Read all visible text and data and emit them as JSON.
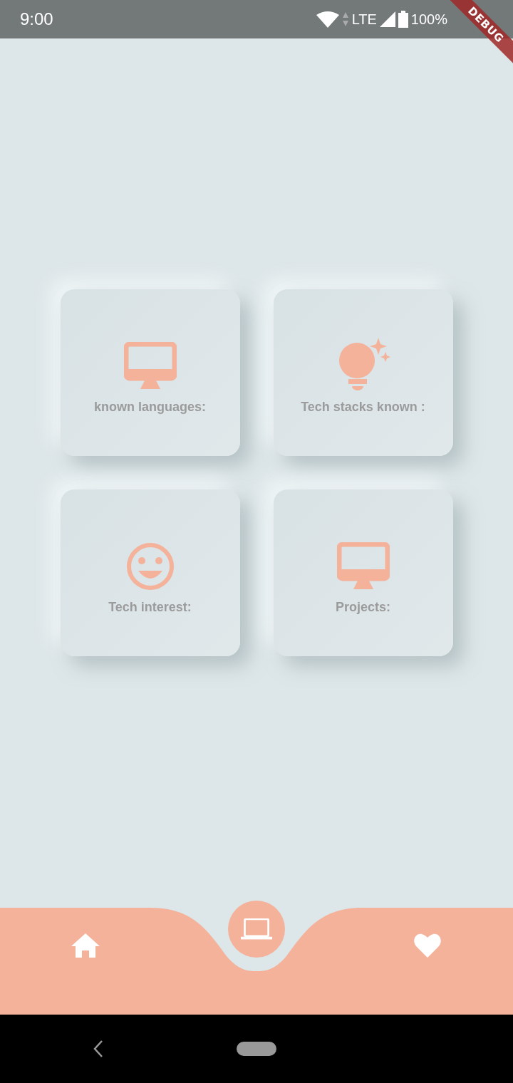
{
  "status_bar": {
    "time": "9:00",
    "network": "LTE",
    "battery": "100%"
  },
  "debug_banner": "DEBUG",
  "cards": [
    {
      "kind": "monitor",
      "label": "known languages:"
    },
    {
      "kind": "bulb",
      "label": "Tech stacks known :"
    },
    {
      "kind": "smiley",
      "label": "Tech interest:"
    },
    {
      "kind": "monitor",
      "label": "Projects:"
    }
  ],
  "bottom_nav": [
    {
      "kind": "home",
      "selected": false
    },
    {
      "kind": "laptop",
      "selected": true
    },
    {
      "kind": "heart",
      "selected": false
    }
  ]
}
